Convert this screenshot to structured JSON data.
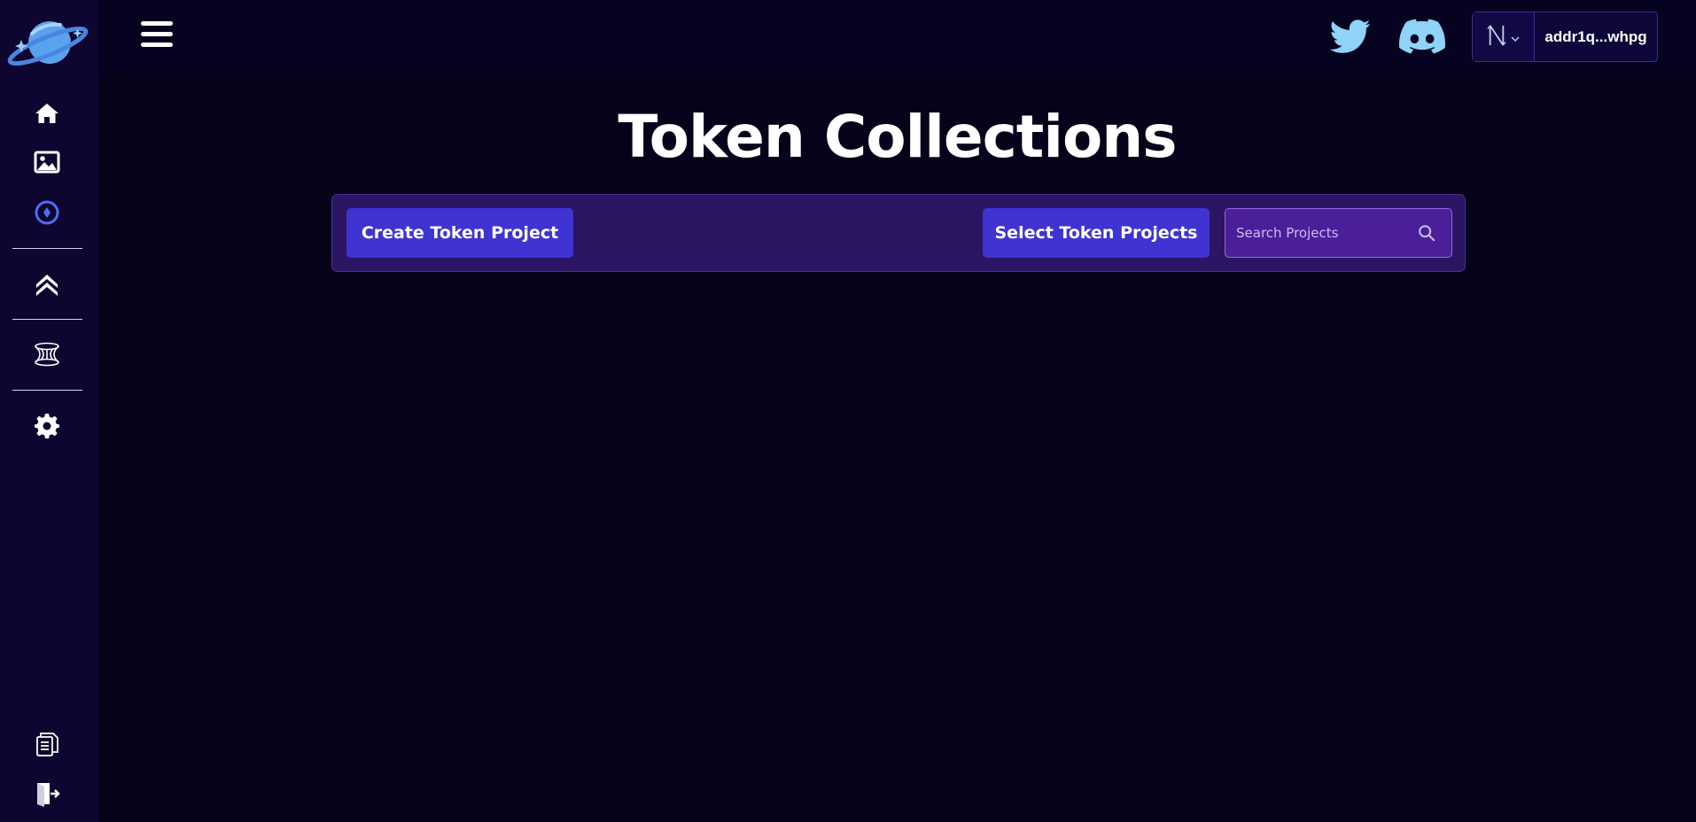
{
  "sidebar": {
    "logo_icon": "planet-logo-icon",
    "nav": [
      {
        "icon": "home-icon"
      },
      {
        "icon": "image-icon"
      },
      {
        "icon": "token-icon",
        "active": true
      },
      {
        "icon": "double-chevron-up-icon"
      },
      {
        "icon": "wormhole-icon"
      },
      {
        "icon": "gear-icon"
      },
      {
        "icon": "documents-icon"
      },
      {
        "icon": "logout-icon"
      }
    ]
  },
  "header": {
    "menu_icon": "hamburger-menu-icon",
    "social": [
      {
        "icon": "twitter-icon"
      },
      {
        "icon": "discord-icon"
      }
    ],
    "wallet": {
      "icon": "nami-wallet-icon",
      "address": "addr1q...whpg"
    }
  },
  "main": {
    "title": "Token Collections",
    "toolbar": {
      "create_label": "Create Token Project",
      "select_label": "Select Token Projects",
      "search_placeholder": "Search Projects"
    }
  },
  "colors": {
    "background": "#05021a",
    "sidebar": "#0e0530",
    "toolbar": "#2c1562",
    "button": "#3f33d1",
    "accent_icon": "#4c6ff0",
    "social_icon": "#8fd3f7"
  }
}
